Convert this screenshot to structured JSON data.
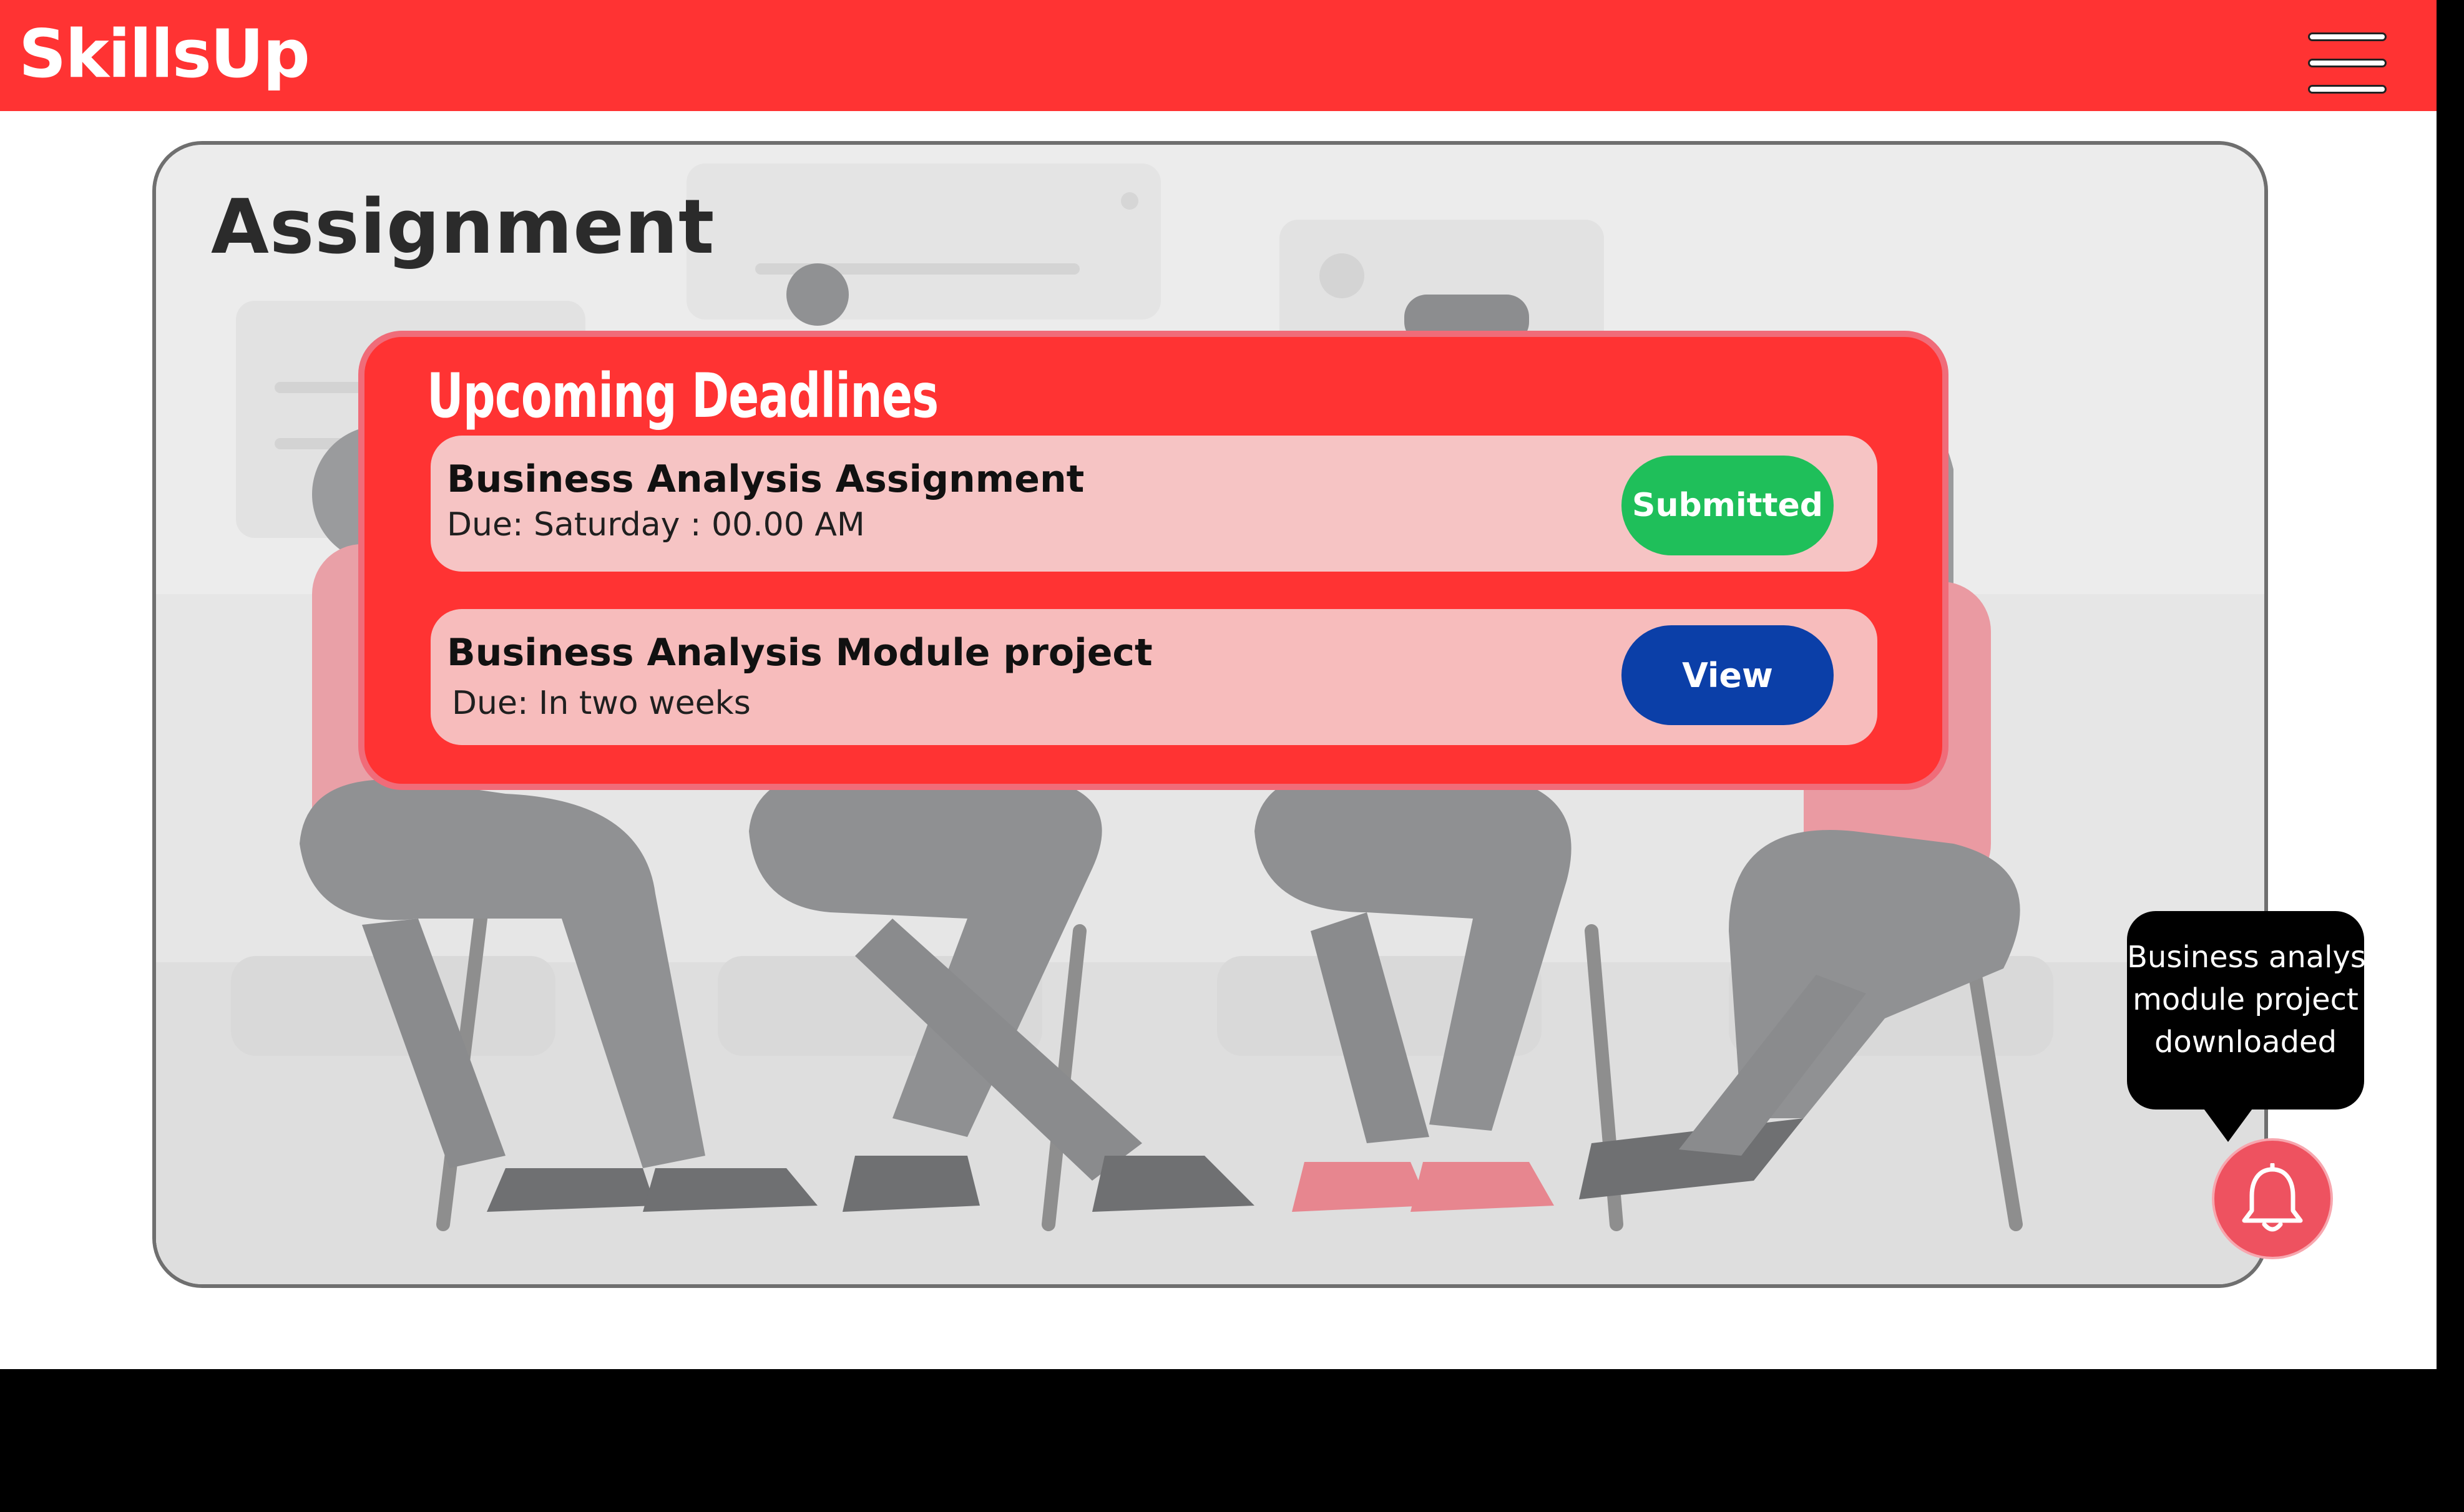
{
  "app": {
    "brand": "SkillsUp",
    "menu_icon": "hamburger-menu-icon",
    "colors": {
      "brand_red": "#ff3333",
      "submitted_green": "#1fbf5a",
      "view_blue": "#0b3fa8",
      "row_pink": "#f6c4c4",
      "bell_red": "#ee5260"
    }
  },
  "page": {
    "title": "Assignment"
  },
  "deadlines": {
    "heading": "Upcoming Deadlines",
    "items": [
      {
        "title": "Business Analysis Assignment",
        "due": "Due: Saturday : 00.00 AM",
        "action": "Submitted"
      },
      {
        "title": "Business Analysis Module project",
        "due": "Due: In two weeks",
        "action": "View"
      }
    ]
  },
  "notification": {
    "lines": [
      "Business analysis",
      "module project",
      "downloaded"
    ],
    "icon": "bell-icon"
  }
}
